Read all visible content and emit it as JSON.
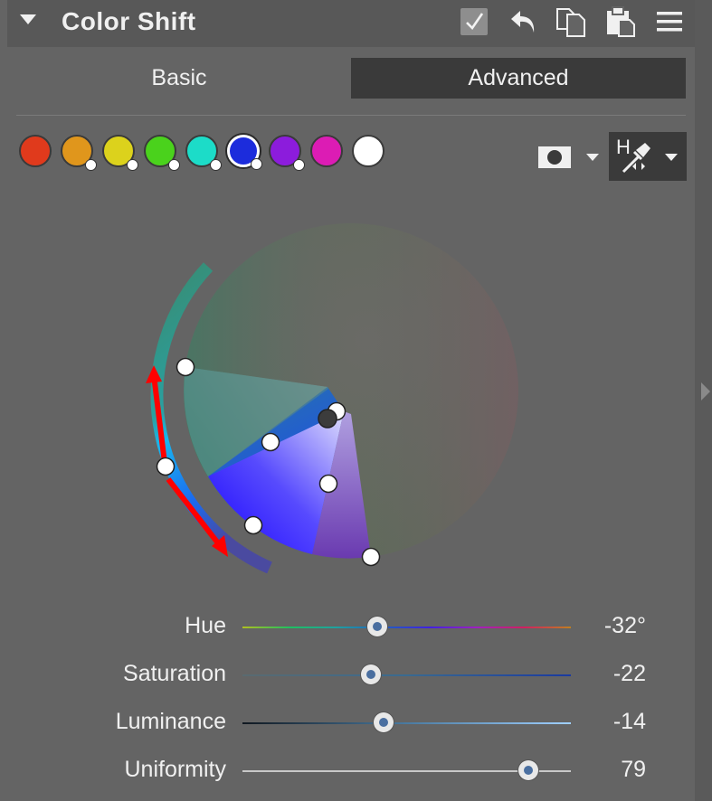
{
  "panel": {
    "title": "Color Shift",
    "header_icons": [
      "checkbox-checked-icon",
      "undo-icon",
      "copy-icon",
      "paste-icon",
      "menu-icon"
    ]
  },
  "tabs": [
    {
      "label": "Basic",
      "active": false
    },
    {
      "label": "Advanced",
      "active": true
    }
  ],
  "swatches": [
    {
      "name": "red",
      "color": "#e03a1c",
      "adjusted": false,
      "selected": false
    },
    {
      "name": "orange",
      "color": "#e0961c",
      "adjusted": true,
      "selected": false
    },
    {
      "name": "yellow",
      "color": "#dcd21c",
      "adjusted": true,
      "selected": false
    },
    {
      "name": "green",
      "color": "#4ad21c",
      "adjusted": true,
      "selected": false
    },
    {
      "name": "cyan",
      "color": "#1cdcc8",
      "adjusted": true,
      "selected": false
    },
    {
      "name": "blue",
      "color": "#1c2cdc",
      "adjusted": true,
      "selected": true
    },
    {
      "name": "purple",
      "color": "#8c1cdc",
      "adjusted": true,
      "selected": false
    },
    {
      "name": "magenta",
      "color": "#dc1cb4",
      "adjusted": false,
      "selected": false
    },
    {
      "name": "white",
      "color": "#ffffff",
      "adjusted": false,
      "selected": false
    }
  ],
  "tools": {
    "mask_icon": "mask-icon",
    "picker_label": "H",
    "picker_icon": "eyedropper-icon"
  },
  "sliders": [
    {
      "label": "Hue",
      "value": "-32°",
      "position": 0.41
    },
    {
      "label": "Saturation",
      "value": "-22",
      "position": 0.39
    },
    {
      "label": "Luminance",
      "value": "-14",
      "position": 0.43
    },
    {
      "label": "Uniformity",
      "value": "79",
      "position": 0.87
    }
  ]
}
